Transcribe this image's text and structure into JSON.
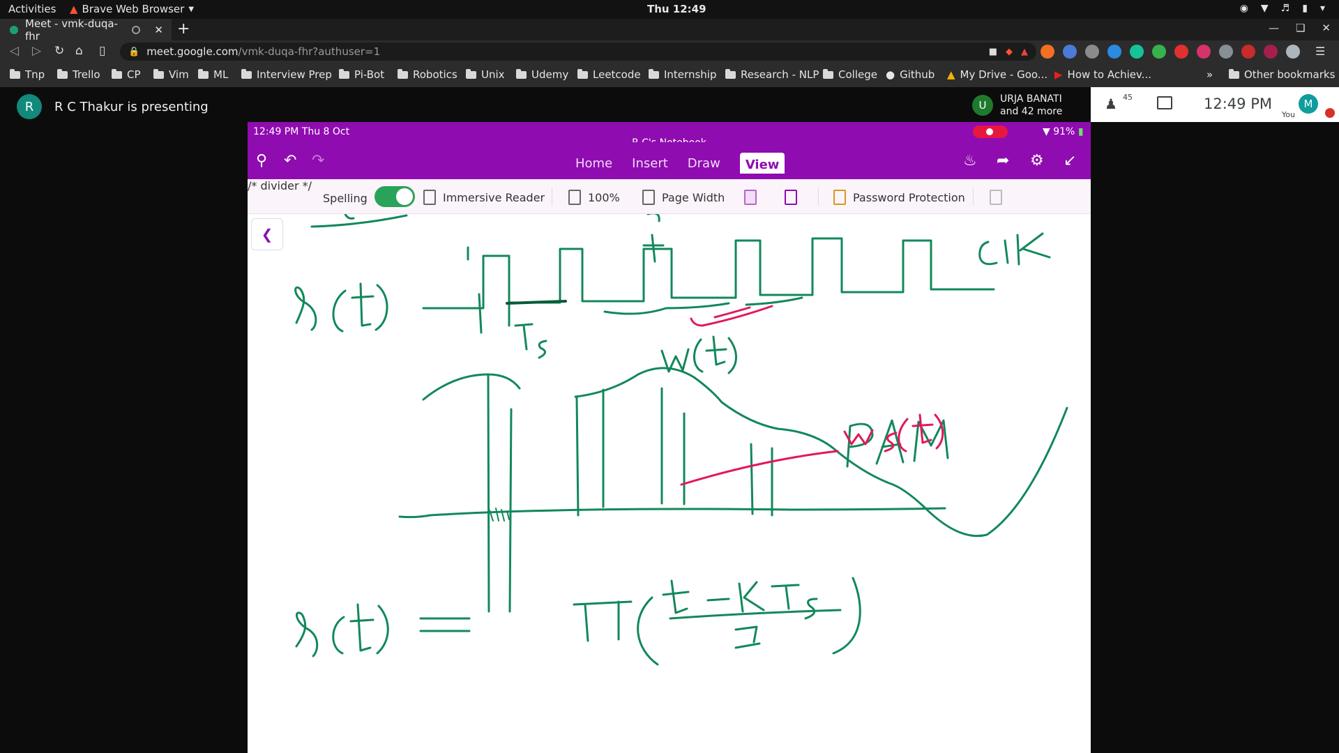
{
  "system": {
    "activities": "Activities",
    "app_name": "Brave Web Browser",
    "clock": "Thu 12:49"
  },
  "browser": {
    "tab_title": "Meet - vmk-duqa-fhr",
    "url_domain": "meet.google.com",
    "url_path": "/vmk-duqa-fhr?authuser=1",
    "bookmarks": [
      "Tnp",
      "Trello",
      "CP",
      "Vim",
      "ML",
      "Interview Prep",
      "Pi-Bot",
      "Robotics",
      "Unix",
      "Udemy",
      "Leetcode",
      "Internship",
      "Research - NLP",
      "College",
      "Github",
      "My Drive - Goo...",
      "How to Achiev..."
    ],
    "other_bookmarks": "Other bookmarks",
    "overflow": "»"
  },
  "meet": {
    "presenter_initial": "R",
    "presenter_text": "R C Thakur is presenting",
    "participant_initial": "U",
    "participant_name": "URJA BANATI",
    "participant_more": "and 42 more",
    "people_count": "45",
    "time": "12:49 PM",
    "self_initial": "M",
    "self_label": "You"
  },
  "ipad": {
    "time": "12:49 PM   Thu 8 Oct",
    "notebook": "R C's Notebook",
    "battery": "91%",
    "tabs": [
      "Home",
      "Insert",
      "Draw",
      "View"
    ],
    "active_tab": "View",
    "view_tools": {
      "spelling": "Spelling",
      "immersive_reader": "Immersive Reader",
      "zoom": "100%",
      "page_width": "Page Width",
      "password_protection": "Password Protection"
    }
  },
  "colors": {
    "onenote_purple": "#8f0cb0",
    "ink_green": "#12885a",
    "ink_pink": "#e2185c"
  }
}
